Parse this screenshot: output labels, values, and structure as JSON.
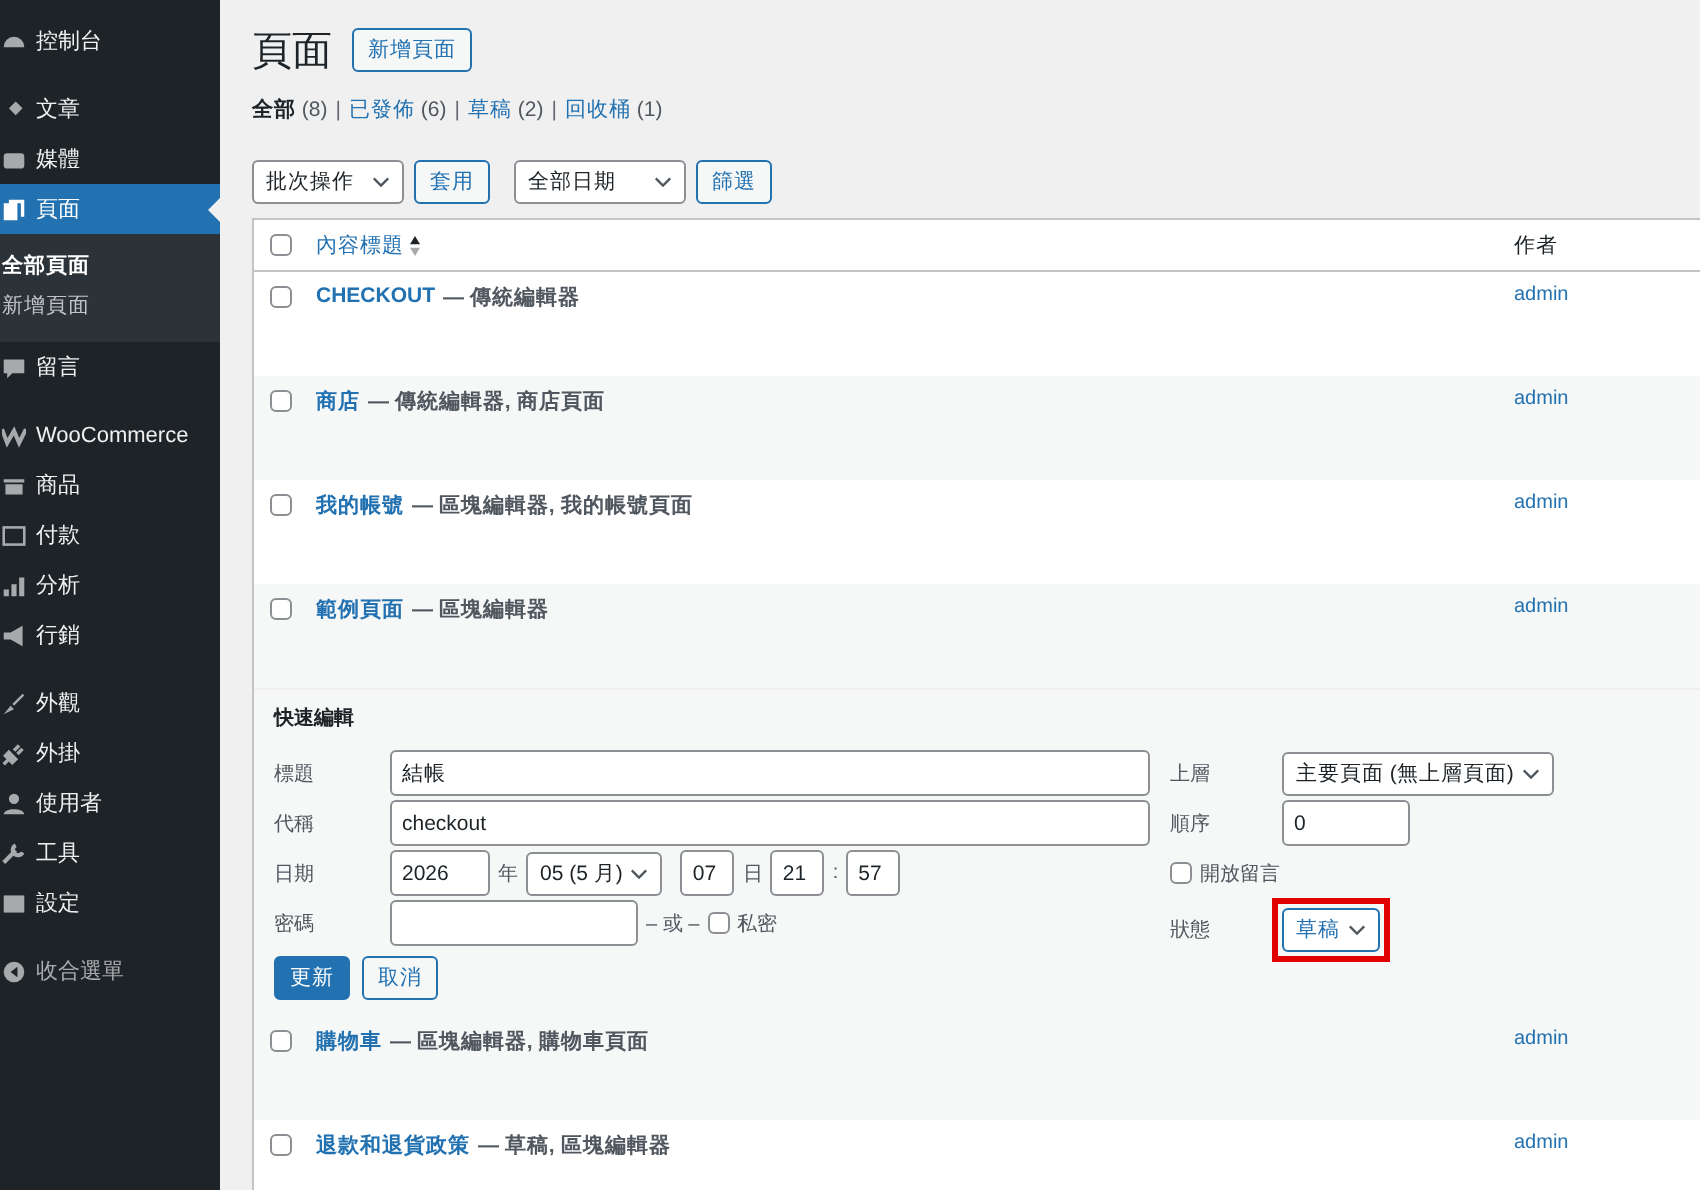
{
  "sidebar": {
    "groups": [
      {
        "items": [
          {
            "label": "控制台",
            "selected": false
          }
        ]
      },
      {
        "items": [
          {
            "label": "文章",
            "selected": false
          },
          {
            "label": "媒體",
            "selected": false
          },
          {
            "label": "頁面",
            "selected": true,
            "children": [
              {
                "label": "全部頁面",
                "selected": true
              },
              {
                "label": "新增頁面",
                "selected": false
              }
            ]
          },
          {
            "label": "留言",
            "selected": false
          }
        ]
      },
      {
        "items": [
          {
            "label": "WooCommerce",
            "selected": false
          },
          {
            "label": "商品",
            "selected": false
          },
          {
            "label": "付款",
            "selected": false
          },
          {
            "label": "分析",
            "selected": false
          },
          {
            "label": "行銷",
            "selected": false
          }
        ]
      },
      {
        "items": [
          {
            "label": "外觀",
            "selected": false
          },
          {
            "label": "外掛",
            "selected": false
          },
          {
            "label": "使用者",
            "selected": false
          },
          {
            "label": "工具",
            "selected": false
          },
          {
            "label": "設定",
            "selected": false
          }
        ]
      }
    ],
    "collapse_label": "收合選單"
  },
  "page": {
    "title": "頁面",
    "add_button": "新增頁面"
  },
  "filters": [
    {
      "label": "全部",
      "count": "(8)",
      "selected": true
    },
    {
      "separator": "|",
      "label": "已發佈",
      "count": "(6)",
      "selected": false
    },
    {
      "separator": "|",
      "label": "草稿",
      "count": "(2)",
      "selected": false
    },
    {
      "separator": "|",
      "label": "回收桶",
      "count": "(1)",
      "selected": false
    }
  ],
  "toolbar": {
    "bulk_select": "批次操作",
    "apply_button": "套用",
    "date_select": "全部日期",
    "filter_button": "篩選"
  },
  "table": {
    "columns": [
      "內容標題",
      "作者"
    ],
    "select_all_checked": false,
    "rows": [
      {
        "kind": "page",
        "title": "CHECKOUT",
        "state": "— 傳統編輯器",
        "author": "admin",
        "checked": false
      },
      {
        "kind": "page",
        "title": "商店",
        "state": "— 傳統編輯器, 商店頁面",
        "author": "admin",
        "checked": false
      },
      {
        "kind": "page",
        "title": "我的帳號",
        "state": "— 區塊編輯器, 我的帳號頁面",
        "author": "admin",
        "checked": false
      },
      {
        "kind": "page",
        "title": "範例頁面",
        "state": "— 區塊編輯器",
        "author": "admin",
        "checked": false
      },
      {
        "kind": "quick_edit",
        "heading": "快速編輯",
        "title_label": "標題",
        "title_value": "結帳",
        "slug_label": "代稱",
        "slug_value": "checkout",
        "date_label": "日期",
        "year": "2026",
        "year_unit": "年",
        "month": "05 (5 月)",
        "day": "07",
        "day_unit": "日",
        "hour": "21",
        "time_sep": ":",
        "minute": "57",
        "password_label": "密碼",
        "or_text": "– 或 –",
        "private_label": "私密",
        "private_checked": false,
        "parent_label": "上層",
        "parent_value": "主要頁面 (無上層頁面)",
        "order_label": "順序",
        "order_value": "0",
        "comments_label": "開放留言",
        "comments_checked": false,
        "status_label": "狀態",
        "status_value": "草稿",
        "status_highlighted": true,
        "update_button": "更新",
        "cancel_button": "取消"
      },
      {
        "kind": "page",
        "title": "購物車",
        "state": "— 區塊編輯器, 購物車頁面",
        "author": "admin",
        "checked": false
      },
      {
        "kind": "page",
        "title": "退款和退貨政策",
        "state": "— 草稿, 區塊編輯器",
        "author": "admin",
        "checked": false
      }
    ]
  }
}
